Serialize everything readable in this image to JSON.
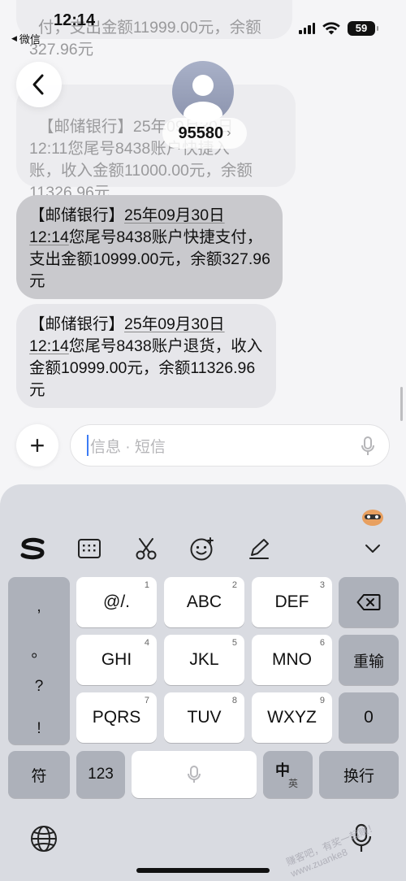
{
  "status_bar": {
    "time": "12:14",
    "back_app": "微信",
    "battery": "59"
  },
  "contact": {
    "number": "95580"
  },
  "messages": [
    {
      "text": "付，支出金额11999.00元，余额\n327.96元"
    },
    {
      "text_head": "【邮储银行】25年09月30日\n12:11您尾号8438账户快捷入\n账，收入金额11000.00元，余额\n11326.96元"
    },
    {
      "bank": "【邮储银行】",
      "date": "25年09月30日",
      "time": "12:14",
      "body": "您尾号8438账户快捷支付，支出金额10999.00元，余额327.96元"
    },
    {
      "bank": "【邮储银行】",
      "date": "25年09月30日",
      "time": "12:14",
      "body": "您尾号8438账户退货，收入金额10999.00元，余额11326.96元"
    }
  ],
  "input": {
    "placeholder": "信息 · 短信"
  },
  "keyboard": {
    "punct": [
      ",",
      "。",
      "?",
      "!"
    ],
    "rows": [
      [
        {
          "label": "@/.",
          "num": "1"
        },
        {
          "label": "ABC",
          "num": "2"
        },
        {
          "label": "DEF",
          "num": "3"
        }
      ],
      [
        {
          "label": "GHI",
          "num": "4"
        },
        {
          "label": "JKL",
          "num": "5"
        },
        {
          "label": "MNO",
          "num": "6"
        }
      ],
      [
        {
          "label": "PQRS",
          "num": "7"
        },
        {
          "label": "TUV",
          "num": "8"
        },
        {
          "label": "WXYZ",
          "num": "9"
        }
      ]
    ],
    "reenter": "重输",
    "zero": "0",
    "symbols": "符",
    "num_switch": "123",
    "lang_main": "中",
    "lang_sub": "英",
    "return": "换行"
  },
  "watermark": "赚客吧，有奖一起赚！www.zuanke8"
}
